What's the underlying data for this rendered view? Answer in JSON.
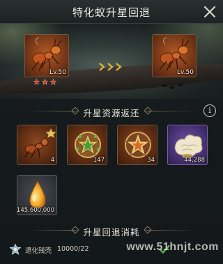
{
  "header": {
    "title": "特化蚁升星回退"
  },
  "preview": {
    "from": {
      "level": "Lv.50",
      "stars": 3
    },
    "to": {
      "level": "Lv.50",
      "stars": 0
    }
  },
  "returns": {
    "title": "升星资源返还",
    "items": [
      {
        "icon": "ant-fragment-icon",
        "quantity": "4"
      },
      {
        "icon": "green-star-medal-icon",
        "quantity": "147"
      },
      {
        "icon": "orange-star-medal-icon",
        "quantity": "34"
      },
      {
        "icon": "fungus-icon",
        "quantity": "44,288"
      },
      {
        "icon": "honeydew-drop-icon",
        "quantity": "145,600,000"
      }
    ]
  },
  "cost": {
    "title": "升星回退消耗",
    "item_label": "退化残壳",
    "item_value": "10000/22",
    "icon": "shell-crystal-icon"
  },
  "watermark": "www.51hnjt.com",
  "colors": {
    "star": "#d8342c",
    "arrow": "#e6b43a",
    "confirm": "#58b84a"
  }
}
